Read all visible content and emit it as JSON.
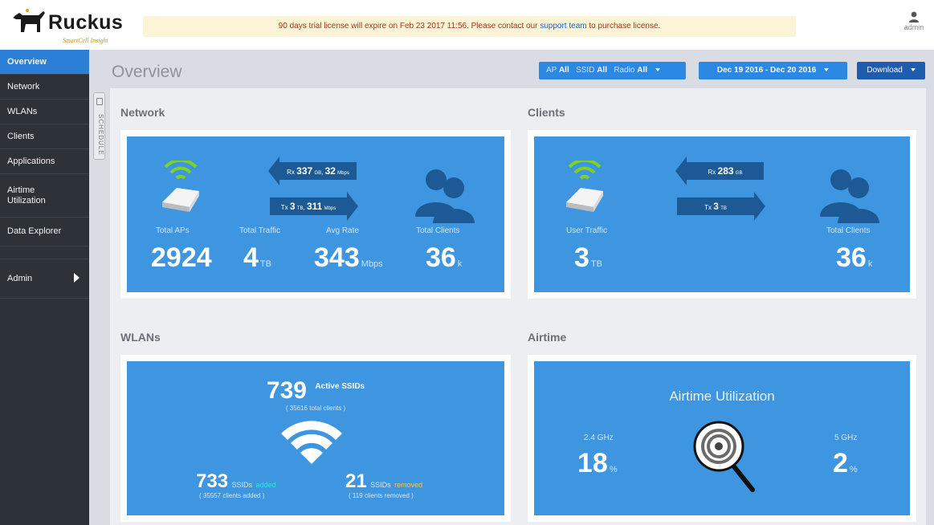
{
  "brand": {
    "name": "Ruckus",
    "subtitle": "SmartCell Insight"
  },
  "banner": {
    "before": "90 days trial license will expire on Feb 23 2017 11:56. Please contact our ",
    "link": "support team",
    "after": " to purchase license."
  },
  "user": {
    "name": "admin"
  },
  "sidebar": {
    "items": [
      {
        "label": "Overview"
      },
      {
        "label": "Network"
      },
      {
        "label": "WLANs"
      },
      {
        "label": "Clients"
      },
      {
        "label": "Applications"
      },
      {
        "label": "Airtime Utilization"
      },
      {
        "label": "Data Explorer"
      },
      {
        "label": "Admin"
      }
    ]
  },
  "schedule": {
    "label": "SCHEDULE"
  },
  "page": {
    "title": "Overview"
  },
  "filters": {
    "ap_label": "AP",
    "ap_value": "All",
    "ssid_label": "SSID",
    "ssid_value": "All",
    "radio_label": "Radio",
    "radio_value": "All"
  },
  "daterange": {
    "label": "Dec 19 2016 - Dec 20 2016"
  },
  "download": {
    "label": "Download"
  },
  "network": {
    "title": "Network",
    "rx_prefix": "Rx",
    "rx_value1": "337",
    "rx_unit1": "GB",
    "rx_value2": "32",
    "rx_unit2": "Mbps",
    "tx_prefix": "Tx",
    "tx_value1": "3",
    "tx_unit1": "TB",
    "tx_value2": "311",
    "tx_unit2": "Mbps",
    "total_aps_label": "Total APs",
    "total_aps": "2924",
    "total_traffic_label": "Total Traffic",
    "total_traffic": "4",
    "total_traffic_unit": "TB",
    "avg_rate_label": "Avg Rate",
    "avg_rate": "343",
    "avg_rate_unit": "Mbps",
    "total_clients_label": "Total Clients",
    "total_clients": "36",
    "total_clients_unit": "k"
  },
  "clients": {
    "title": "Clients",
    "rx_prefix": "Rx",
    "rx_value": "283",
    "rx_unit": "GB",
    "tx_prefix": "Tx",
    "tx_value": "3",
    "tx_unit": "TB",
    "user_traffic_label": "User Traffic",
    "user_traffic": "3",
    "user_traffic_unit": "TB",
    "total_clients_label": "Total Clients",
    "total_clients": "36",
    "total_clients_unit": "k"
  },
  "wlans": {
    "title": "WLANs",
    "active": "739",
    "active_label": "Active SSIDs",
    "total_clients": "( 35616 total clients )",
    "added": "733",
    "added_prefix": "SSIDs",
    "added_word": "added",
    "added_clients": "( 35557 clients added )",
    "removed": "21",
    "removed_prefix": "SSIDs",
    "removed_word": "removed",
    "removed_clients": "( 119 clients removed )"
  },
  "airtime": {
    "title": "Airtime",
    "heading": "Airtime Utilization",
    "band1_label": "2.4 GHz",
    "band1_value": "18",
    "band1_unit": "%",
    "band2_label": "5 GHz",
    "band2_value": "2",
    "band2_unit": "%"
  },
  "colors": {
    "accent": "#2b89e4",
    "panel": "#3f96e0",
    "sidebar": "#2d3138",
    "added": "#3ee0e0",
    "removed": "#f2c94c"
  }
}
